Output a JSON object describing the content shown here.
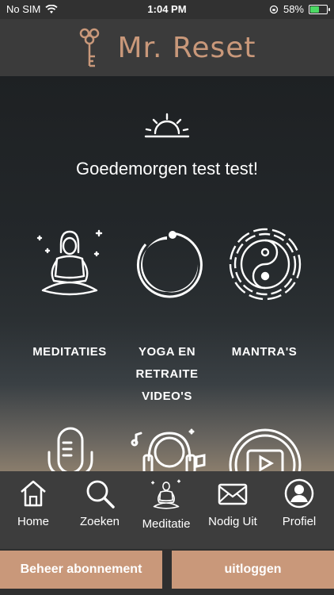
{
  "status_bar": {
    "carrier": "No SIM",
    "time": "1:04 PM",
    "battery": "58%",
    "battery_level": 0.58
  },
  "header": {
    "title": "Mr. Reset",
    "logo_icon": "key-icon",
    "accent_color": "#c9987a"
  },
  "main": {
    "greeting": "Goedemorgen test test!",
    "tiles": [
      {
        "label_lines": [
          "MEDITATIES"
        ],
        "icon": "meditation-icon"
      },
      {
        "label_lines": [
          "YOGA EN",
          "RETRAITE",
          "VIDEO'S"
        ],
        "icon": "enso-circle-icon"
      },
      {
        "label_lines": [
          "MANTRA'S"
        ],
        "icon": "yin-yang-icon"
      },
      {
        "icon": "microphone-icon"
      },
      {
        "icon": "headphones-music-icon"
      },
      {
        "icon": "video-play-icon"
      }
    ]
  },
  "tabbar": {
    "items": [
      {
        "label": "Home",
        "icon": "home-icon"
      },
      {
        "label": "Zoeken",
        "icon": "search-icon"
      },
      {
        "label": "Meditatie",
        "icon": "meditation-icon",
        "active": true
      },
      {
        "label": "Nodig Uit",
        "icon": "envelope-icon"
      },
      {
        "label": "Profiel",
        "icon": "profile-icon"
      }
    ]
  },
  "buttons": {
    "manage": "Beheer abonnement",
    "logout": "uitloggen"
  }
}
